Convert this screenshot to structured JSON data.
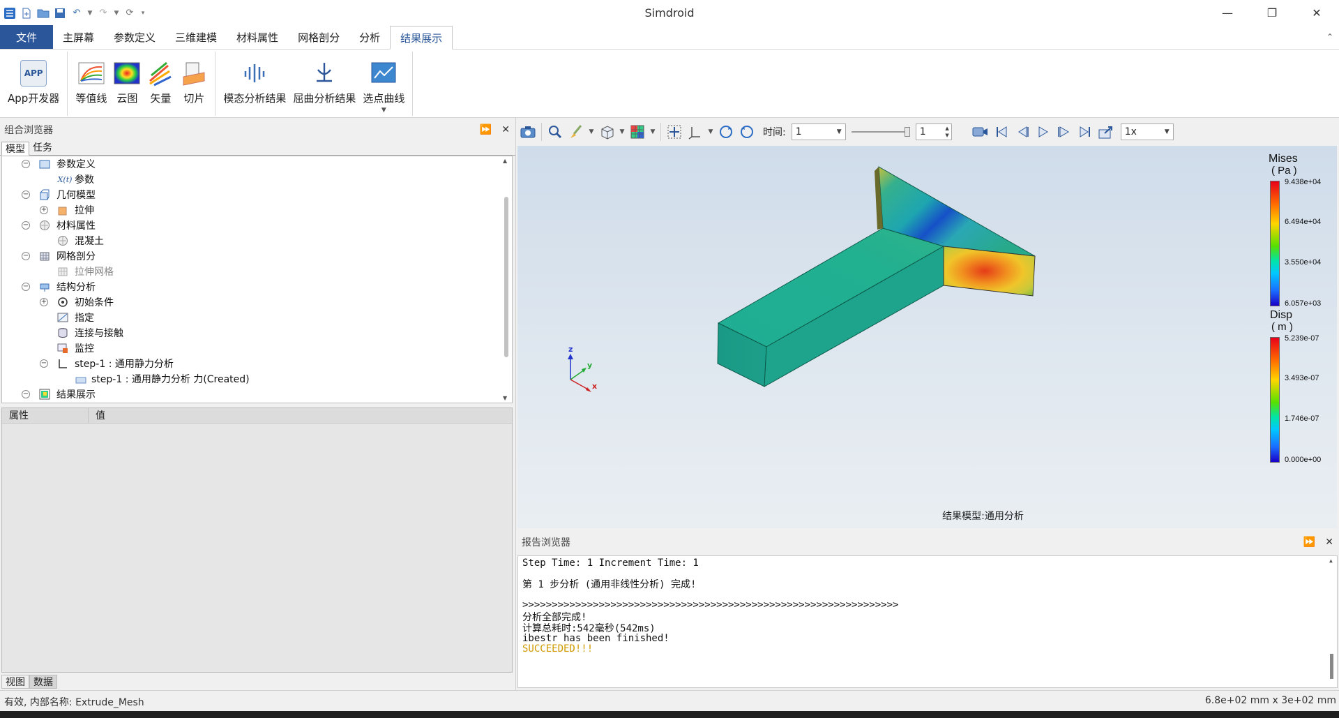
{
  "window": {
    "title": "Simdroid",
    "minimize": "—",
    "maximize": "❐",
    "close": "✕"
  },
  "ribbon_tabs": [
    {
      "label": "文件"
    },
    {
      "label": "主屏幕"
    },
    {
      "label": "参数定义"
    },
    {
      "label": "三维建模"
    },
    {
      "label": "材料属性"
    },
    {
      "label": "网格剖分"
    },
    {
      "label": "分析"
    },
    {
      "label": "结果展示"
    }
  ],
  "ribbon": {
    "app_dev": {
      "label": "App开发器",
      "icon_text": "APP"
    },
    "contour_lines": {
      "label": "等值线"
    },
    "cloud_map": {
      "label": "云图"
    },
    "vector": {
      "label": "矢量"
    },
    "slice": {
      "label": "切片"
    },
    "modal_results": {
      "label": "模态分析结果"
    },
    "buckling_results": {
      "label": "屈曲分析结果"
    },
    "point_curve": {
      "label": "选点曲线"
    }
  },
  "combo_browser": {
    "title": "组合浏览器",
    "tabs": [
      "模型",
      "任务"
    ],
    "tree": [
      {
        "label": "参数定义",
        "icon": "parameter-definition-icon"
      },
      {
        "label": "参数",
        "icon": "parameter-icon",
        "prefix": "X(t)"
      },
      {
        "label": "几何模型",
        "icon": "geometry-model-icon"
      },
      {
        "label": "拉伸",
        "icon": "extrude-icon"
      },
      {
        "label": "材料属性",
        "icon": "material-icon"
      },
      {
        "label": "混凝土",
        "icon": "concrete-icon"
      },
      {
        "label": "网格剖分",
        "icon": "mesh-icon"
      },
      {
        "label": "拉伸网格",
        "icon": "extrude-mesh-icon"
      },
      {
        "label": "结构分析",
        "icon": "structural-analysis-icon"
      },
      {
        "label": "初始条件",
        "icon": "initial-condition-icon"
      },
      {
        "label": "指定",
        "icon": "specify-icon"
      },
      {
        "label": "连接与接触",
        "icon": "contact-icon"
      },
      {
        "label": "监控",
        "icon": "monitor-icon"
      },
      {
        "label": "step-1 : 通用静力分析",
        "icon": "step-icon"
      },
      {
        "label": "step-1 : 通用静力分析 力(Created)",
        "icon": "force-icon"
      },
      {
        "label": "结果展示",
        "icon": "results-icon"
      }
    ]
  },
  "properties": {
    "col_property": "属性",
    "col_value": "值"
  },
  "bottom_tabs": [
    "视图",
    "数据"
  ],
  "viewport_toolbar": {
    "time_label": "时间:",
    "time_value": "1",
    "frame_value": "1",
    "speed_value": "1x"
  },
  "legend_mises": {
    "title": "Mises",
    "unit": "( Pa )",
    "ticks": [
      "9.438e+04",
      "6.494e+04",
      "3.550e+04",
      "6.057e+03"
    ]
  },
  "legend_disp": {
    "title": "Disp",
    "unit": "( m )",
    "ticks": [
      "5.239e-07",
      "3.493e-07",
      "1.746e-07",
      "0.000e+00"
    ]
  },
  "axes": {
    "x": "x",
    "y": "y",
    "z": "z"
  },
  "viewport_label": "结果模型:通用分析",
  "report_browser": {
    "title": "报告浏览器",
    "lines": [
      "Step Time: 1 Increment Time: 1",
      "第 1 步分析 (通用非线性分析) 完成!",
      ">>>>>>>>>>>>>>>>>>>>>>>>>>>>>>>>>>>>>>>>>>>>>>>>>>>>>>>>>>>>>>>>",
      "分析全部完成!",
      "计算总耗时:542毫秒(542ms)",
      "ibestr has been finished!",
      "SUCCEEDED!!!"
    ]
  },
  "status": {
    "left": "有效, 内部名称: Extrude_Mesh",
    "right": "6.8e+02 mm x 3e+02 mm"
  },
  "colors": {
    "accent": "#2b579a",
    "success": "#d09a00"
  }
}
